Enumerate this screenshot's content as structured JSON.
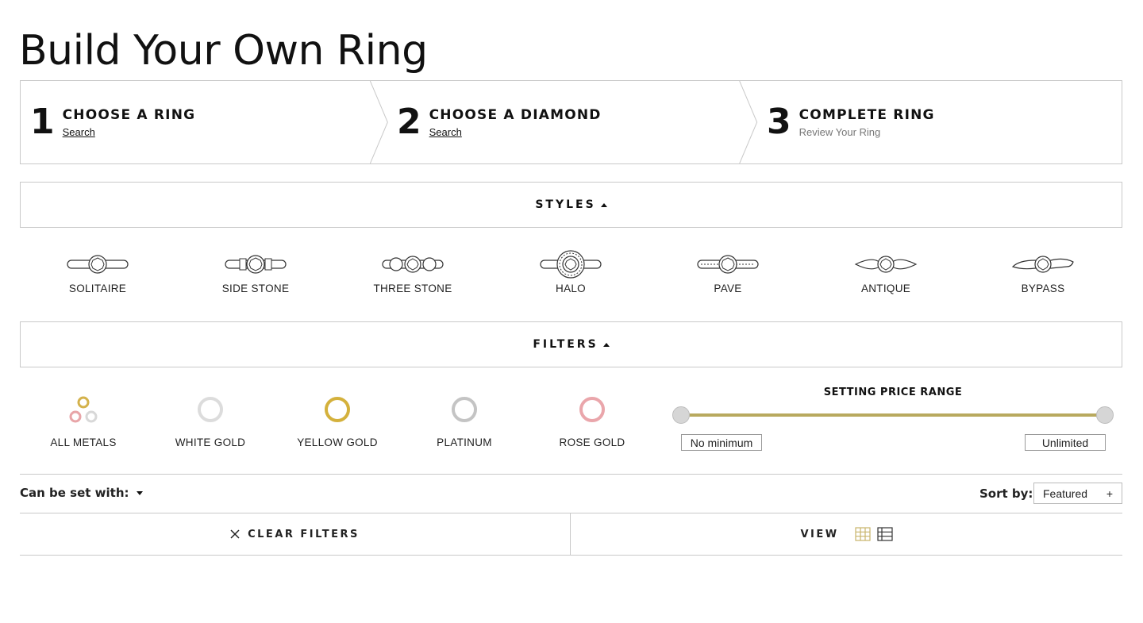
{
  "page": {
    "title": "Build Your Own Ring"
  },
  "steps": [
    {
      "number": "1",
      "title": "CHOOSE A RING",
      "subtitle": "Search"
    },
    {
      "number": "2",
      "title": "CHOOSE A DIAMOND",
      "subtitle": "Search"
    },
    {
      "number": "3",
      "title": "COMPLETE RING",
      "subtitle": "Review Your Ring"
    }
  ],
  "styles_section": {
    "label": "STYLES",
    "icon": "caret-up-icon"
  },
  "styles": [
    {
      "label": "SOLITAIRE",
      "icon": "solitaire-ring-icon"
    },
    {
      "label": "SIDE STONE",
      "icon": "side-stone-ring-icon"
    },
    {
      "label": "THREE STONE",
      "icon": "three-stone-ring-icon"
    },
    {
      "label": "HALO",
      "icon": "halo-ring-icon"
    },
    {
      "label": "PAVE",
      "icon": "pave-ring-icon"
    },
    {
      "label": "ANTIQUE",
      "icon": "antique-ring-icon"
    },
    {
      "label": "BYPASS",
      "icon": "bypass-ring-icon"
    }
  ],
  "filters_section": {
    "label": "FILTERS",
    "icon": "caret-up-icon"
  },
  "metals": [
    {
      "label": "ALL METALS",
      "colors": [
        "#d4b24c",
        "#e8a5a8",
        "#d8d8d8"
      ]
    },
    {
      "label": "WHITE GOLD",
      "colors": [
        "#dcdcdc"
      ]
    },
    {
      "label": "YELLOW GOLD",
      "colors": [
        "#d4b13c"
      ]
    },
    {
      "label": "PLATINUM",
      "colors": [
        "#c4c4c4"
      ]
    },
    {
      "label": "ROSE GOLD",
      "colors": [
        "#eaa6ab"
      ]
    }
  ],
  "price_range": {
    "title": "SETTING PRICE RANGE",
    "min_label": "No minimum",
    "max_label": "Unlimited",
    "track_color": "#b8a95e",
    "min_fraction": 0,
    "max_fraction": 1
  },
  "set_with": {
    "label": "Can be set with:"
  },
  "sort": {
    "label": "Sort by:",
    "value": "Featured",
    "icon": "+"
  },
  "clear_filters": {
    "label": "CLEAR FILTERS",
    "icon": "close-icon"
  },
  "view": {
    "label": "VIEW",
    "grid_icon": "grid-view-icon",
    "list_icon": "list-view-icon",
    "active_color": "#c8b46a"
  }
}
